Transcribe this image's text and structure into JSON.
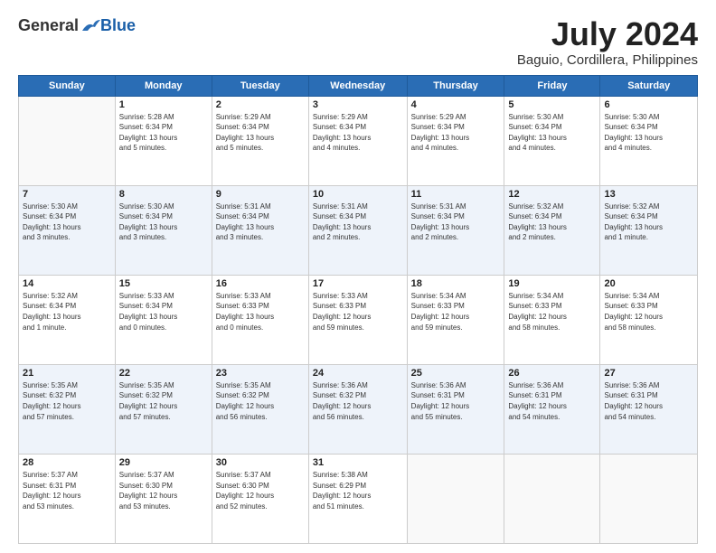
{
  "header": {
    "logo": {
      "general": "General",
      "blue": "Blue"
    },
    "title": "July 2024",
    "location": "Baguio, Cordillera, Philippines"
  },
  "calendar": {
    "days_of_week": [
      "Sunday",
      "Monday",
      "Tuesday",
      "Wednesday",
      "Thursday",
      "Friday",
      "Saturday"
    ],
    "weeks": [
      [
        {
          "day": "",
          "info": ""
        },
        {
          "day": "1",
          "info": "Sunrise: 5:28 AM\nSunset: 6:34 PM\nDaylight: 13 hours\nand 5 minutes."
        },
        {
          "day": "2",
          "info": "Sunrise: 5:29 AM\nSunset: 6:34 PM\nDaylight: 13 hours\nand 5 minutes."
        },
        {
          "day": "3",
          "info": "Sunrise: 5:29 AM\nSunset: 6:34 PM\nDaylight: 13 hours\nand 4 minutes."
        },
        {
          "day": "4",
          "info": "Sunrise: 5:29 AM\nSunset: 6:34 PM\nDaylight: 13 hours\nand 4 minutes."
        },
        {
          "day": "5",
          "info": "Sunrise: 5:30 AM\nSunset: 6:34 PM\nDaylight: 13 hours\nand 4 minutes."
        },
        {
          "day": "6",
          "info": "Sunrise: 5:30 AM\nSunset: 6:34 PM\nDaylight: 13 hours\nand 4 minutes."
        }
      ],
      [
        {
          "day": "7",
          "info": "Sunrise: 5:30 AM\nSunset: 6:34 PM\nDaylight: 13 hours\nand 3 minutes."
        },
        {
          "day": "8",
          "info": "Sunrise: 5:30 AM\nSunset: 6:34 PM\nDaylight: 13 hours\nand 3 minutes."
        },
        {
          "day": "9",
          "info": "Sunrise: 5:31 AM\nSunset: 6:34 PM\nDaylight: 13 hours\nand 3 minutes."
        },
        {
          "day": "10",
          "info": "Sunrise: 5:31 AM\nSunset: 6:34 PM\nDaylight: 13 hours\nand 2 minutes."
        },
        {
          "day": "11",
          "info": "Sunrise: 5:31 AM\nSunset: 6:34 PM\nDaylight: 13 hours\nand 2 minutes."
        },
        {
          "day": "12",
          "info": "Sunrise: 5:32 AM\nSunset: 6:34 PM\nDaylight: 13 hours\nand 2 minutes."
        },
        {
          "day": "13",
          "info": "Sunrise: 5:32 AM\nSunset: 6:34 PM\nDaylight: 13 hours\nand 1 minute."
        }
      ],
      [
        {
          "day": "14",
          "info": "Sunrise: 5:32 AM\nSunset: 6:34 PM\nDaylight: 13 hours\nand 1 minute."
        },
        {
          "day": "15",
          "info": "Sunrise: 5:33 AM\nSunset: 6:34 PM\nDaylight: 13 hours\nand 0 minutes."
        },
        {
          "day": "16",
          "info": "Sunrise: 5:33 AM\nSunset: 6:33 PM\nDaylight: 13 hours\nand 0 minutes."
        },
        {
          "day": "17",
          "info": "Sunrise: 5:33 AM\nSunset: 6:33 PM\nDaylight: 12 hours\nand 59 minutes."
        },
        {
          "day": "18",
          "info": "Sunrise: 5:34 AM\nSunset: 6:33 PM\nDaylight: 12 hours\nand 59 minutes."
        },
        {
          "day": "19",
          "info": "Sunrise: 5:34 AM\nSunset: 6:33 PM\nDaylight: 12 hours\nand 58 minutes."
        },
        {
          "day": "20",
          "info": "Sunrise: 5:34 AM\nSunset: 6:33 PM\nDaylight: 12 hours\nand 58 minutes."
        }
      ],
      [
        {
          "day": "21",
          "info": "Sunrise: 5:35 AM\nSunset: 6:32 PM\nDaylight: 12 hours\nand 57 minutes."
        },
        {
          "day": "22",
          "info": "Sunrise: 5:35 AM\nSunset: 6:32 PM\nDaylight: 12 hours\nand 57 minutes."
        },
        {
          "day": "23",
          "info": "Sunrise: 5:35 AM\nSunset: 6:32 PM\nDaylight: 12 hours\nand 56 minutes."
        },
        {
          "day": "24",
          "info": "Sunrise: 5:36 AM\nSunset: 6:32 PM\nDaylight: 12 hours\nand 56 minutes."
        },
        {
          "day": "25",
          "info": "Sunrise: 5:36 AM\nSunset: 6:31 PM\nDaylight: 12 hours\nand 55 minutes."
        },
        {
          "day": "26",
          "info": "Sunrise: 5:36 AM\nSunset: 6:31 PM\nDaylight: 12 hours\nand 54 minutes."
        },
        {
          "day": "27",
          "info": "Sunrise: 5:36 AM\nSunset: 6:31 PM\nDaylight: 12 hours\nand 54 minutes."
        }
      ],
      [
        {
          "day": "28",
          "info": "Sunrise: 5:37 AM\nSunset: 6:31 PM\nDaylight: 12 hours\nand 53 minutes."
        },
        {
          "day": "29",
          "info": "Sunrise: 5:37 AM\nSunset: 6:30 PM\nDaylight: 12 hours\nand 53 minutes."
        },
        {
          "day": "30",
          "info": "Sunrise: 5:37 AM\nSunset: 6:30 PM\nDaylight: 12 hours\nand 52 minutes."
        },
        {
          "day": "31",
          "info": "Sunrise: 5:38 AM\nSunset: 6:29 PM\nDaylight: 12 hours\nand 51 minutes."
        },
        {
          "day": "",
          "info": ""
        },
        {
          "day": "",
          "info": ""
        },
        {
          "day": "",
          "info": ""
        }
      ]
    ]
  }
}
